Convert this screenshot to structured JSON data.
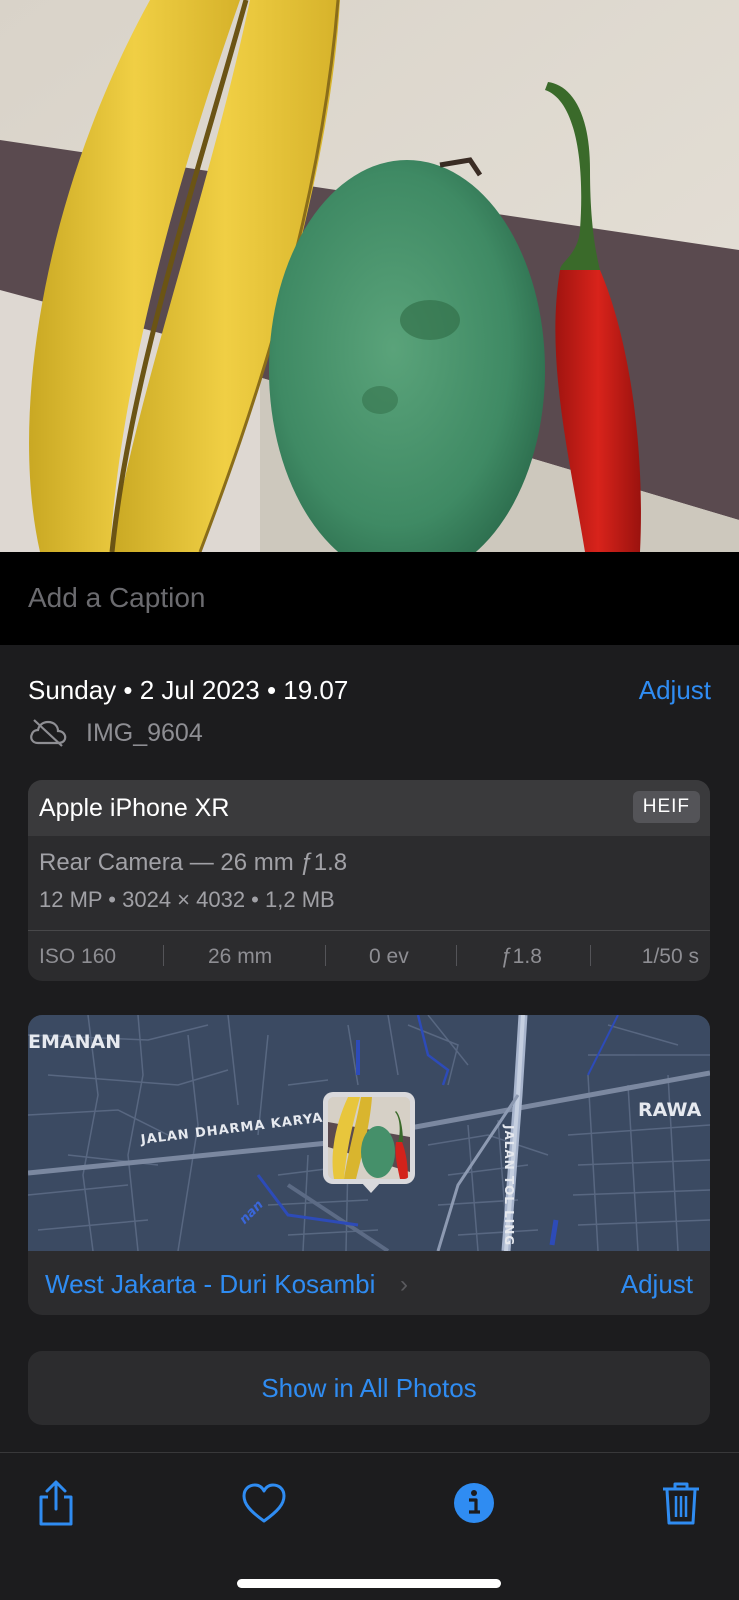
{
  "caption": {
    "placeholder": "Add a Caption"
  },
  "info": {
    "date": "Sunday • 2 Jul 2023 • 19.07",
    "adjust_label": "Adjust",
    "file_name": "IMG_9604",
    "cloud_icon": "cloud-slash-icon"
  },
  "camera": {
    "model": "Apple iPhone XR",
    "format": "HEIF",
    "lens": "Rear Camera — 26 mm ƒ1.8",
    "specs": "12 MP  •  3024 × 4032  •  1,2 MB",
    "exif": {
      "iso": "ISO 160",
      "focal": "26 mm",
      "ev": "0 ev",
      "aperture": "ƒ1.8",
      "shutter": "1/50 s"
    }
  },
  "map": {
    "labels": {
      "west": "EMANAN",
      "east": "RAWA",
      "road": "JALAN DHARMA KARYA",
      "toll": "JALAN TOL LING",
      "canal": "nan"
    },
    "location": "West Jakarta - Duri Kosambi",
    "adjust_label": "Adjust"
  },
  "show_all_label": "Show in All Photos",
  "toolbar": {
    "share_icon": "share-icon",
    "favorite_icon": "heart-icon",
    "info_icon": "info-icon",
    "delete_icon": "trash-icon"
  },
  "colors": {
    "accent": "#2f8cf2",
    "panel": "#1c1c1e",
    "card": "#2c2c2e"
  }
}
